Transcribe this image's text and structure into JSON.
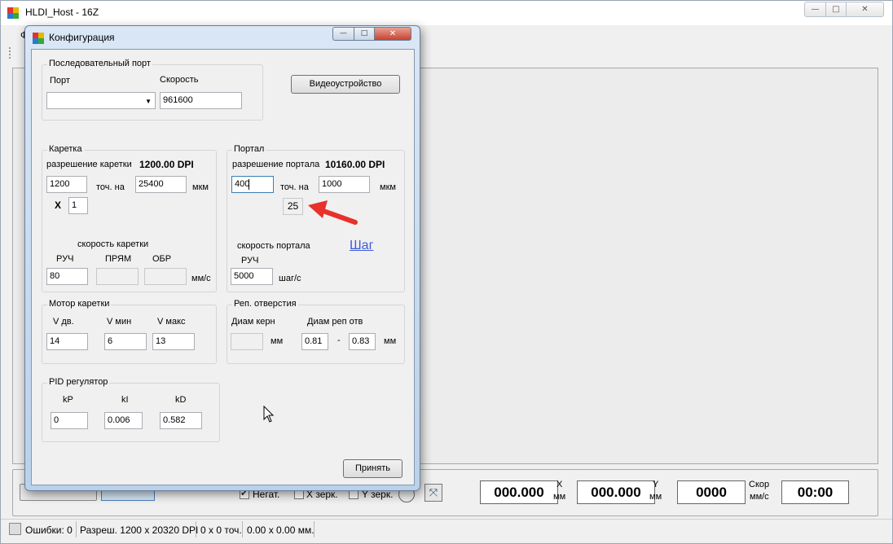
{
  "main_window": {
    "title": "HLDI_Host - 16Z",
    "menu_first": "Ф",
    "controls": {
      "minimize": "—",
      "maximize": "□",
      "close": "✕"
    }
  },
  "bottom_panel": {
    "negat_label": "Негат.",
    "negat_checked": true,
    "xmirror_label": "X зерк.",
    "ymirror_label": "Y зерк.",
    "x_value": "000.000",
    "x_label": "X",
    "x_unit": "мм",
    "y_value": "000.000",
    "y_label": "Y",
    "y_unit": "мм",
    "speed_value": "0000",
    "speed_label": "Скор",
    "speed_unit": "мм/с",
    "time_value": "00:00",
    "collapse_icon": "⤧"
  },
  "statusbar": {
    "errors": "Ошибки: 0",
    "resolution": "Разреш. 1200 x 20320 DPI",
    "points": "0 x 0 точ.",
    "size": "0.00 x 0.00 мм."
  },
  "dialog": {
    "title": "Конфигурация",
    "controls": {
      "minimize": "—",
      "maximize": "□",
      "close": "✕"
    },
    "serial": {
      "title": "Последовательный порт",
      "port_label": "Порт",
      "port_value": "",
      "speed_label": "Скорость",
      "speed_value": "961600"
    },
    "video_button": "Видеоустройство",
    "carriage": {
      "title": "Каретка",
      "resolution_label": "разрешение каретки",
      "resolution_value": "1200.00 DPI",
      "points": "1200",
      "per_label": "точ. на",
      "microns": "25400",
      "microns_unit": "мкм",
      "x_label": "X",
      "x_mult": "1",
      "speed_label": "скорость каретки",
      "manual_label": "РУЧ",
      "forward_label": "ПРЯМ",
      "reverse_label": "ОБР",
      "manual_value": "80",
      "forward_value": "",
      "reverse_value": "",
      "speed_unit": "мм/с"
    },
    "portal": {
      "title": "Портал",
      "resolution_label": "разрешение портала",
      "resolution_value": "10160.00 DPI",
      "points": "400",
      "per_label": "точ. на",
      "microns": "1000",
      "microns_unit": "мкм",
      "step_value": "25",
      "speed_label": "скорость портала",
      "manual_label": "РУЧ",
      "manual_value": "5000",
      "speed_unit": "шаг/с"
    },
    "annotation": "Шаг",
    "motor": {
      "title": "Мотор каретки",
      "v_dv_label": "V дв.",
      "v_min_label": "V мин",
      "v_max_label": "V макс",
      "v_dv": "14",
      "v_min": "6",
      "v_max": "13"
    },
    "ref_holes": {
      "title": "Реп. отверстия",
      "core_diam_label": "Диам керн",
      "core_diam_value": "",
      "core_unit": "мм",
      "ref_diam_label": "Диам реп отв",
      "ref_min": "0.81",
      "dash": "-",
      "ref_max": "0.83",
      "ref_unit": "мм"
    },
    "pid": {
      "title": "PID регулятор",
      "kp_label": "kP",
      "ki_label": "kI",
      "kd_label": "kD",
      "kp": "0",
      "ki": "0.006",
      "kd": "0.582"
    },
    "apply_button": "Принять"
  }
}
